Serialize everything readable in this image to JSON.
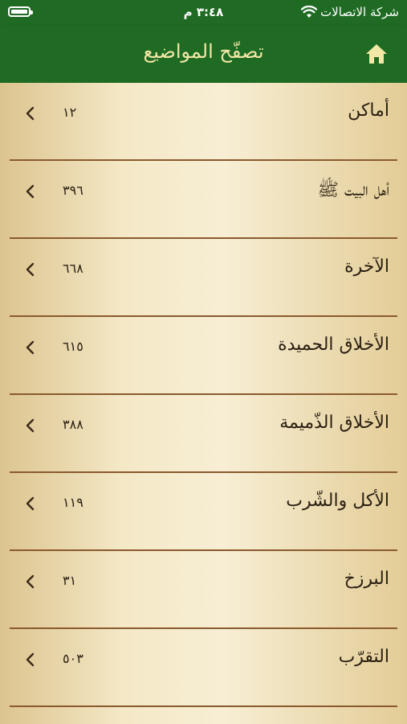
{
  "status_bar": {
    "carrier": "شركة الاتصالات",
    "time": "٣:٤٨ م",
    "wifi_icon": "wifi-icon",
    "battery_icon": "battery-icon",
    "battery_level": 1.0
  },
  "nav": {
    "title": "تصفّح المواضيع",
    "home_icon": "home-icon"
  },
  "colors": {
    "header_bg": "#1f6b24",
    "title_text": "#f3e7a6",
    "separator": "#8a5a2e"
  },
  "topics": [
    {
      "label": "أماكن",
      "count": "١٢"
    },
    {
      "label": "أهل البيت ﷺ",
      "count": "٣٩٦"
    },
    {
      "label": "الآخرة",
      "count": "٦٦٨"
    },
    {
      "label": "الأخلاق الحميدة",
      "count": "٦١٥"
    },
    {
      "label": "الأخلاق الذّميمة",
      "count": "٣٨٨"
    },
    {
      "label": "الأكل والشّرب",
      "count": "١١٩"
    },
    {
      "label": "البرزخ",
      "count": "٣١"
    },
    {
      "label": "التقرّب",
      "count": "٥٠٣"
    }
  ]
}
